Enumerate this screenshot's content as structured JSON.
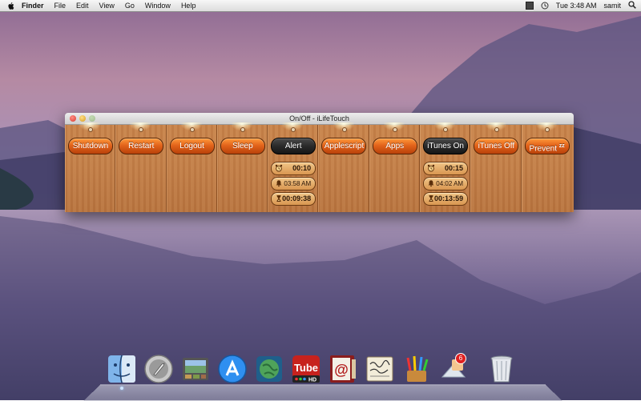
{
  "menubar": {
    "app_name": "Finder",
    "items": [
      "File",
      "Edit",
      "View",
      "Go",
      "Window",
      "Help"
    ],
    "clock": "Tue 3:48 AM",
    "user": "samit"
  },
  "window": {
    "title": "On/Off - iLifeTouch"
  },
  "columns": [
    {
      "button": "Shutdown"
    },
    {
      "button": "Restart"
    },
    {
      "button": "Logout"
    },
    {
      "button": "Sleep"
    },
    {
      "button": "Alert",
      "active": true,
      "timer": "00:10",
      "time": "03:58 AM",
      "countdown": "00:09:38"
    },
    {
      "button": "Applescript"
    },
    {
      "button": "Apps"
    },
    {
      "button": "iTunes On",
      "active": true,
      "timer": "00:15",
      "time": "04:02 AM",
      "countdown": "00:13:59"
    },
    {
      "button": "iTunes Off"
    },
    {
      "button": "Prevent",
      "suffix": "zz"
    }
  ],
  "dock": {
    "badge_count": "6",
    "tube_label": "Tube",
    "hd_label": "HD",
    "at_label": "@"
  }
}
